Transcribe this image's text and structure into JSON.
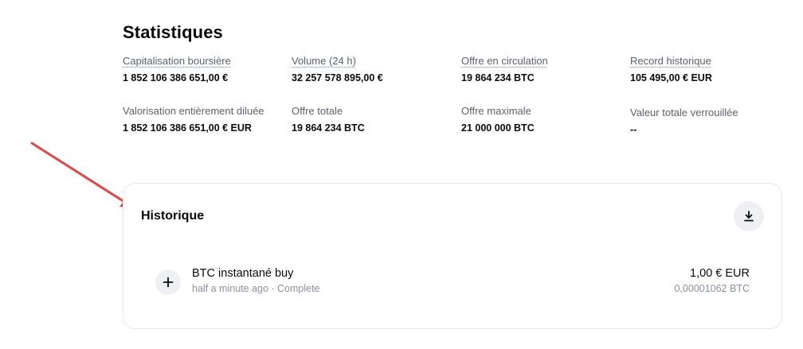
{
  "statistics": {
    "title": "Statistiques",
    "items": [
      {
        "label": "Capitalisation boursière",
        "value": "1 852 106 386 651,00 €"
      },
      {
        "label": "Volume (24 h)",
        "value": "32 257 578 895,00 €"
      },
      {
        "label": "Offre en circulation",
        "value": "19 864 234 BTC"
      },
      {
        "label": "Record historique",
        "value": "105 495,00 € EUR"
      },
      {
        "label": "Valorisation entièrement diluée",
        "value": "1 852 106 386 651,00 € EUR"
      },
      {
        "label": "Offre totale",
        "value": "19 864 234 BTC"
      },
      {
        "label": "Offre maximale",
        "value": "21 000 000 BTC"
      },
      {
        "label": "Valeur totale verrouillée",
        "value": "--"
      }
    ]
  },
  "history": {
    "title": "Historique",
    "download_icon": "download-icon",
    "transactions": [
      {
        "icon": "plus-icon",
        "title": "BTC instantané buy",
        "subtitle": "half a minute ago · Complete",
        "amount": "1,00 € EUR",
        "crypto_amount": "0,00001062 BTC"
      }
    ]
  },
  "annotation": {
    "arrow_color": "#e04848"
  }
}
